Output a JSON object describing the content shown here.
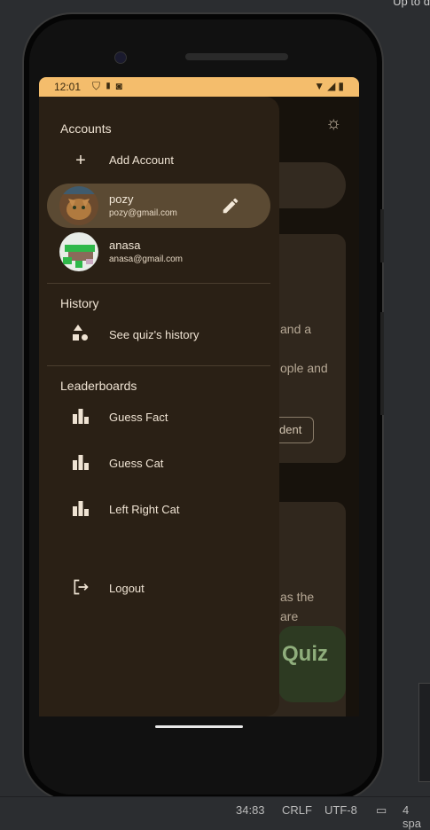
{
  "ide": {
    "top_partial_text": "Up to d",
    "cursor_position": "34:83",
    "line_endings": "CRLF",
    "encoding": "UTF-8",
    "indent": "4 spa"
  },
  "status_bar": {
    "time": "12:01"
  },
  "background": {
    "text_line1": "and a",
    "text_line2": "ople and",
    "button_label": "dent",
    "text_line3": "as the",
    "text_line4": "are",
    "fab_label": "Quiz"
  },
  "drawer": {
    "accounts_title": "Accounts",
    "add_account_label": "Add Account",
    "accounts": [
      {
        "name": "pozy",
        "email": "pozy@gmail.com",
        "selected": true
      },
      {
        "name": "anasa",
        "email": "anasa@gmail.com",
        "selected": false
      }
    ],
    "history_title": "History",
    "history_item": "See quiz's history",
    "leaderboards_title": "Leaderboards",
    "leaderboards": [
      "Guess Fact",
      "Guess Cat",
      "Left Right Cat"
    ],
    "logout_label": "Logout"
  },
  "colors": {
    "status_bar": "#f4bd6c",
    "drawer_bg": "#2a2015",
    "selected_item": "#5b4a33"
  }
}
